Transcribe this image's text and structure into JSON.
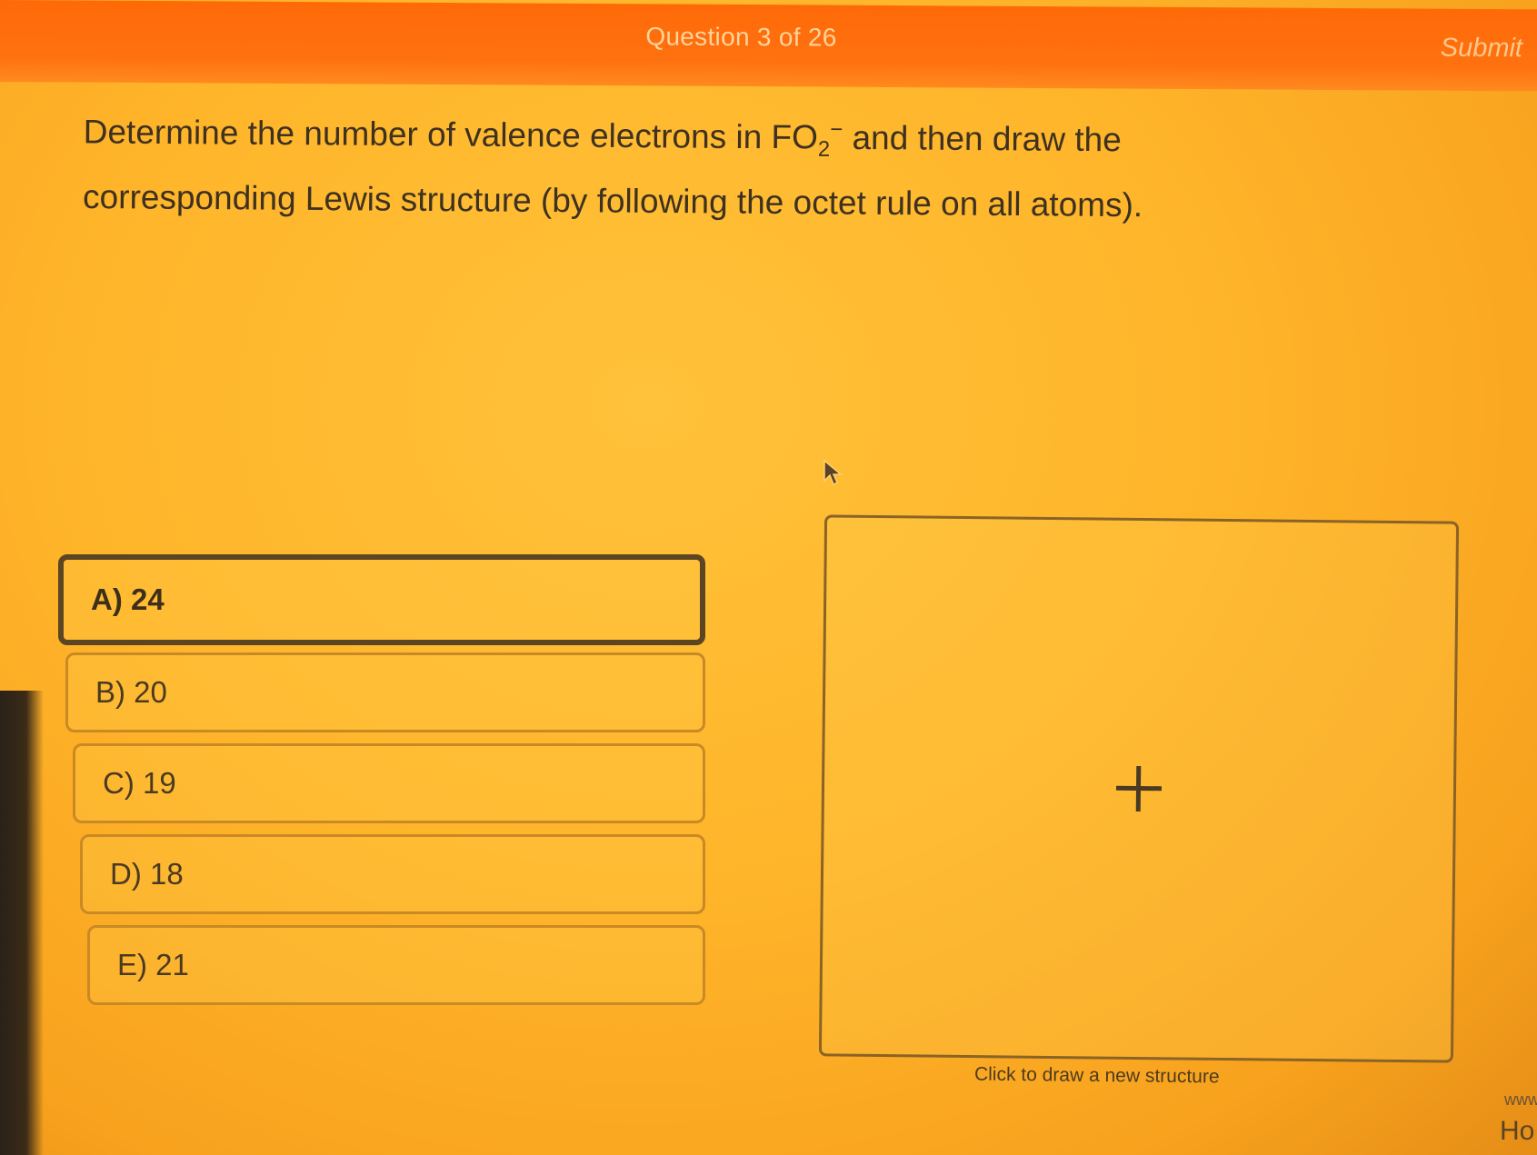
{
  "header": {
    "question_counter": "Question 3 of 26",
    "submit_label": "Submit"
  },
  "question": {
    "text_before": "Determine the number of valence electrons in ",
    "formula_base": "FO",
    "formula_subscript": "2",
    "formula_charge": "−",
    "text_after": " and then draw the corresponding Lewis structure (by following the octet rule on all atoms)."
  },
  "options": [
    {
      "label": "A) 24",
      "selected": true
    },
    {
      "label": "B) 20",
      "selected": false
    },
    {
      "label": "C) 19",
      "selected": false
    },
    {
      "label": "D) 18",
      "selected": false
    },
    {
      "label": "E) 21",
      "selected": false
    }
  ],
  "drawing_area": {
    "caption": "Click to draw a new structure",
    "icon": "plus-icon"
  },
  "edge_fragments": {
    "www": "www",
    "ho": "Ho"
  },
  "colors": {
    "header_bg": "#ff6a08",
    "page_bg": "#ffb52a",
    "text": "#3e3120",
    "selected_border": "#5b4523"
  }
}
